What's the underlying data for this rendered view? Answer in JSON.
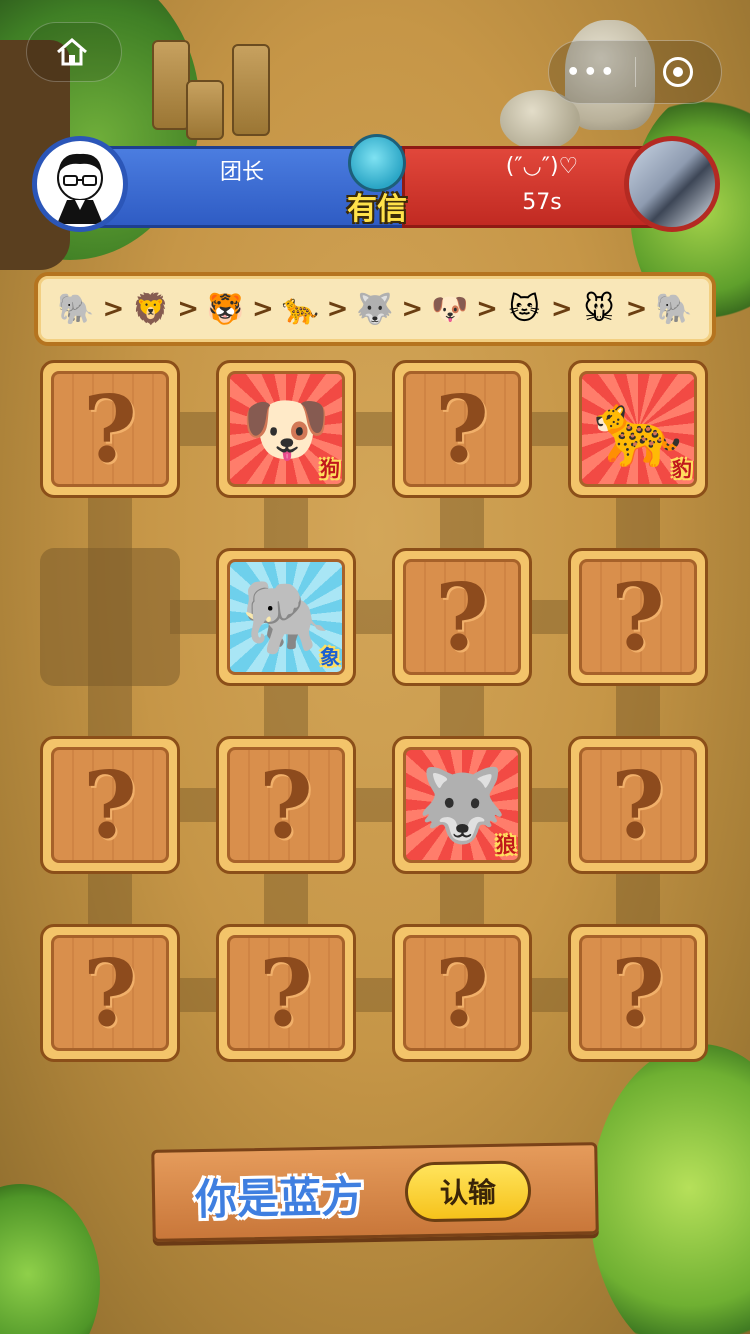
{
  "players": {
    "left": {
      "name": "团长"
    },
    "right": {
      "name": "(″◡″)♡",
      "timer": "57s"
    }
  },
  "mascot": {
    "label": "有信"
  },
  "chain": [
    "elephant",
    "lion",
    "tiger",
    "leopard",
    "wolf",
    "dog",
    "cat",
    "mouse",
    "elephant"
  ],
  "board": {
    "tiles": [
      {
        "state": "hidden"
      },
      {
        "state": "revealed",
        "animal": "dog",
        "tag": "狗",
        "team": "red"
      },
      {
        "state": "hidden"
      },
      {
        "state": "revealed",
        "animal": "leopard",
        "tag": "豹",
        "team": "red"
      },
      {
        "state": "empty"
      },
      {
        "state": "revealed",
        "animal": "elephant",
        "tag": "象",
        "team": "blue"
      },
      {
        "state": "hidden"
      },
      {
        "state": "hidden"
      },
      {
        "state": "hidden"
      },
      {
        "state": "hidden"
      },
      {
        "state": "revealed",
        "animal": "wolf",
        "tag": "狼",
        "team": "red"
      },
      {
        "state": "hidden"
      },
      {
        "state": "hidden"
      },
      {
        "state": "hidden"
      },
      {
        "state": "hidden"
      },
      {
        "state": "hidden"
      }
    ],
    "hidden_mark": "?"
  },
  "footer": {
    "team_label": "你是蓝方",
    "surrender_label": "认输"
  },
  "colors": {
    "blue_team": "#2f5cc4",
    "red_team": "#c12a22",
    "wood": "#d98f4c"
  }
}
